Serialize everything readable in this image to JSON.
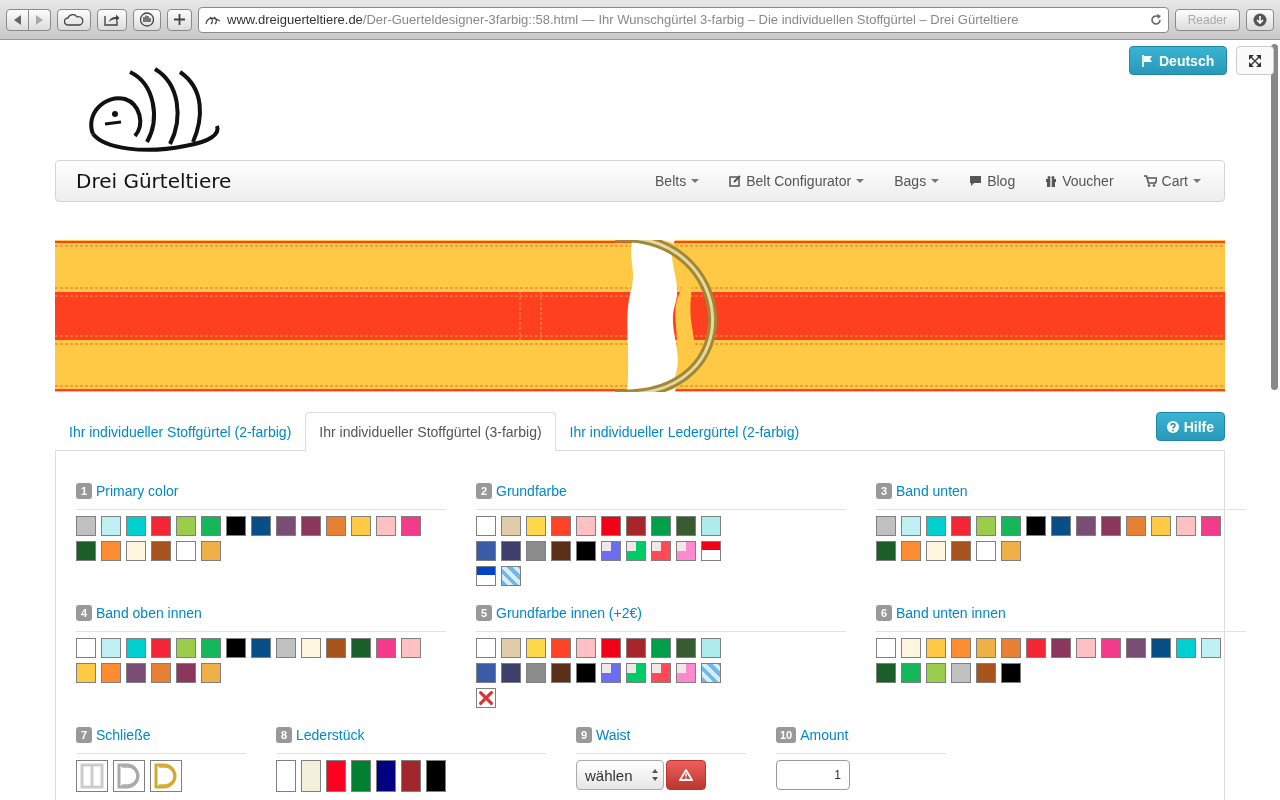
{
  "browser": {
    "url_domain": "www.dreiguerteltiere.de",
    "url_path": "/Der-Guerteldesigner-3farbig::58.html",
    "page_title": " — Ihr Wunschgürtel 3-farbig – Die individuellen Stoffgürtel – Drei Gürteltiere",
    "reader_button": "Reader"
  },
  "language_button": "Deutsch",
  "brand": "Drei Gürteltiere",
  "nav": [
    {
      "label": "Belts",
      "kind": "plain",
      "has_menu": true
    },
    {
      "label": "Belt Configurator",
      "kind": "edit",
      "has_menu": true
    },
    {
      "label": "Bags",
      "kind": "plain",
      "has_menu": true
    },
    {
      "label": "Blog",
      "kind": "comment",
      "has_menu": false
    },
    {
      "label": "Voucher",
      "kind": "gift",
      "has_menu": false
    },
    {
      "label": "Cart",
      "kind": "cart",
      "has_menu": true
    }
  ],
  "tabs": [
    {
      "label": "Ihr individueller Stoffgürtel (2-farbig)",
      "selected": false
    },
    {
      "label": "Ihr individueller Stoffgürtel (3-farbig)",
      "selected": true
    },
    {
      "label": "Ihr individueller Ledergürtel (2-farbig)",
      "selected": false
    }
  ],
  "help_button": "Hilfe",
  "sections": [
    {
      "number": "1",
      "title": "Primary color",
      "kind": "swatches",
      "swatches": [
        {
          "kind": "solid",
          "color": "#c0c0c0"
        },
        {
          "kind": "solid",
          "color": "#bff0f4"
        },
        {
          "kind": "solid",
          "color": "#00d0d0"
        },
        {
          "kind": "solid",
          "color": "#f42534"
        },
        {
          "kind": "solid",
          "color": "#9bcd4c"
        },
        {
          "kind": "solid",
          "color": "#14b85a"
        },
        {
          "kind": "solid",
          "color": "#000000"
        },
        {
          "kind": "solid",
          "color": "#074f88"
        },
        {
          "kind": "solid",
          "color": "#7a4d77"
        },
        {
          "kind": "solid",
          "color": "#8c365e"
        },
        {
          "kind": "solid",
          "color": "#e88034"
        },
        {
          "kind": "solid",
          "color": "#ffc845"
        },
        {
          "kind": "solid",
          "color": "#ffc0c4"
        },
        {
          "kind": "solid",
          "color": "#f43a8a"
        },
        {
          "kind": "solid",
          "color": "#1a5e2a"
        },
        {
          "kind": "solid",
          "color": "#ff8c30"
        },
        {
          "kind": "solid",
          "color": "#fff6e0"
        },
        {
          "kind": "solid",
          "color": "#a8521c"
        },
        {
          "kind": "solid",
          "color": "#ffffff"
        },
        {
          "kind": "solid",
          "color": "#f0b048"
        }
      ]
    },
    {
      "number": "2",
      "title": "Grundfarbe",
      "kind": "swatches",
      "swatches": [
        {
          "kind": "solid",
          "color": "#ffffff"
        },
        {
          "kind": "solid",
          "color": "#e2cba8"
        },
        {
          "kind": "solid",
          "color": "#ffd84a"
        },
        {
          "kind": "solid",
          "color": "#ff4326"
        },
        {
          "kind": "solid",
          "color": "#ffc0c4"
        },
        {
          "kind": "solid",
          "color": "#f20018"
        },
        {
          "kind": "solid",
          "color": "#a6262c"
        },
        {
          "kind": "solid",
          "color": "#00a04a"
        },
        {
          "kind": "solid",
          "color": "#375c32"
        },
        {
          "kind": "solid",
          "color": "#aeeceb"
        },
        {
          "kind": "solid",
          "color": "#3a5ca8"
        },
        {
          "kind": "solid",
          "color": "#3e3f6c"
        },
        {
          "kind": "solid",
          "color": "#8c8c8c"
        },
        {
          "kind": "solid",
          "color": "#5c3018"
        },
        {
          "kind": "solid",
          "color": "#000000"
        },
        {
          "kind": "check",
          "color": "#6b6ef0"
        },
        {
          "kind": "check",
          "color": "#00cc66"
        },
        {
          "kind": "check",
          "color": "#ff4a55"
        },
        {
          "kind": "check",
          "color": "#ff88d0"
        },
        {
          "kind": "split",
          "color": "#f20018"
        },
        {
          "kind": "split",
          "color": "#0044cc"
        },
        {
          "kind": "stripe",
          "color": "#70b8e8"
        }
      ]
    },
    {
      "number": "3",
      "title": "Band unten",
      "kind": "swatches",
      "swatches": [
        {
          "kind": "solid",
          "color": "#c0c0c0"
        },
        {
          "kind": "solid",
          "color": "#bff0f4"
        },
        {
          "kind": "solid",
          "color": "#00d0d0"
        },
        {
          "kind": "solid",
          "color": "#f42534"
        },
        {
          "kind": "solid",
          "color": "#9bcd4c"
        },
        {
          "kind": "solid",
          "color": "#14b85a"
        },
        {
          "kind": "solid",
          "color": "#000000"
        },
        {
          "kind": "solid",
          "color": "#074f88"
        },
        {
          "kind": "solid",
          "color": "#7a4d77"
        },
        {
          "kind": "solid",
          "color": "#8c365e"
        },
        {
          "kind": "solid",
          "color": "#e88034"
        },
        {
          "kind": "solid",
          "color": "#ffc845"
        },
        {
          "kind": "solid",
          "color": "#ffc0c4"
        },
        {
          "kind": "solid",
          "color": "#f43a8a"
        },
        {
          "kind": "solid",
          "color": "#1a5e2a"
        },
        {
          "kind": "solid",
          "color": "#ff8c30"
        },
        {
          "kind": "solid",
          "color": "#fff6e0"
        },
        {
          "kind": "solid",
          "color": "#a8521c"
        },
        {
          "kind": "solid",
          "color": "#ffffff"
        },
        {
          "kind": "solid",
          "color": "#f0b048"
        }
      ]
    },
    {
      "number": "4",
      "title": "Band oben innen",
      "kind": "swatches",
      "swatches": [
        {
          "kind": "solid",
          "color": "#ffffff"
        },
        {
          "kind": "solid",
          "color": "#bff0f4"
        },
        {
          "kind": "solid",
          "color": "#00d0d0"
        },
        {
          "kind": "solid",
          "color": "#f42534"
        },
        {
          "kind": "solid",
          "color": "#9bcd4c"
        },
        {
          "kind": "solid",
          "color": "#14b85a"
        },
        {
          "kind": "solid",
          "color": "#000000"
        },
        {
          "kind": "solid",
          "color": "#074f88"
        },
        {
          "kind": "solid",
          "color": "#c0c0c0"
        },
        {
          "kind": "solid",
          "color": "#fff6e0"
        },
        {
          "kind": "solid",
          "color": "#a8521c"
        },
        {
          "kind": "solid",
          "color": "#1a5e2a"
        },
        {
          "kind": "solid",
          "color": "#f43a8a"
        },
        {
          "kind": "solid",
          "color": "#ffc0c4"
        },
        {
          "kind": "solid",
          "color": "#ffc845"
        },
        {
          "kind": "solid",
          "color": "#ff8c30"
        },
        {
          "kind": "solid",
          "color": "#7a4d77"
        },
        {
          "kind": "solid",
          "color": "#e88034"
        },
        {
          "kind": "solid",
          "color": "#8c365e"
        },
        {
          "kind": "solid",
          "color": "#f0b048"
        }
      ]
    },
    {
      "number": "5",
      "title": "Grundfarbe innen (+2€)",
      "kind": "swatches",
      "swatches": [
        {
          "kind": "solid",
          "color": "#ffffff"
        },
        {
          "kind": "solid",
          "color": "#e2cba8"
        },
        {
          "kind": "solid",
          "color": "#ffd84a"
        },
        {
          "kind": "solid",
          "color": "#ff4326"
        },
        {
          "kind": "solid",
          "color": "#ffc0c4"
        },
        {
          "kind": "solid",
          "color": "#f20018"
        },
        {
          "kind": "solid",
          "color": "#a6262c"
        },
        {
          "kind": "solid",
          "color": "#00a04a"
        },
        {
          "kind": "solid",
          "color": "#375c32"
        },
        {
          "kind": "solid",
          "color": "#aeeceb"
        },
        {
          "kind": "solid",
          "color": "#3a5ca8"
        },
        {
          "kind": "solid",
          "color": "#3e3f6c"
        },
        {
          "kind": "solid",
          "color": "#8c8c8c"
        },
        {
          "kind": "solid",
          "color": "#5c3018"
        },
        {
          "kind": "solid",
          "color": "#000000"
        },
        {
          "kind": "check",
          "color": "#6b6ef0"
        },
        {
          "kind": "check",
          "color": "#00cc66"
        },
        {
          "kind": "check",
          "color": "#ff4a55"
        },
        {
          "kind": "check",
          "color": "#ff88d0"
        },
        {
          "kind": "stripe",
          "color": "#70b8e8"
        },
        {
          "kind": "none"
        }
      ]
    },
    {
      "number": "6",
      "title": "Band unten innen",
      "kind": "swatches",
      "swatches": [
        {
          "kind": "solid",
          "color": "#ffffff"
        },
        {
          "kind": "solid",
          "color": "#fff6e0"
        },
        {
          "kind": "solid",
          "color": "#ffc845"
        },
        {
          "kind": "solid",
          "color": "#ff8c30"
        },
        {
          "kind": "solid",
          "color": "#f0b048"
        },
        {
          "kind": "solid",
          "color": "#e88034"
        },
        {
          "kind": "solid",
          "color": "#f42534"
        },
        {
          "kind": "solid",
          "color": "#8c365e"
        },
        {
          "kind": "solid",
          "color": "#ffc0c4"
        },
        {
          "kind": "solid",
          "color": "#f43a8a"
        },
        {
          "kind": "solid",
          "color": "#7a4d77"
        },
        {
          "kind": "solid",
          "color": "#074f88"
        },
        {
          "kind": "solid",
          "color": "#00d0d0"
        },
        {
          "kind": "solid",
          "color": "#bff0f4"
        },
        {
          "kind": "solid",
          "color": "#1a5e2a"
        },
        {
          "kind": "solid",
          "color": "#14b85a"
        },
        {
          "kind": "solid",
          "color": "#9bcd4c"
        },
        {
          "kind": "solid",
          "color": "#c0c0c0"
        },
        {
          "kind": "solid",
          "color": "#a8521c"
        },
        {
          "kind": "solid",
          "color": "#000000"
        }
      ]
    },
    {
      "number": "7",
      "title": "Schließe",
      "kind": "clasps",
      "clasps": [
        {
          "kind": "frame",
          "color": "#cccccc"
        },
        {
          "kind": "dring",
          "color": "#aaaaaa"
        },
        {
          "kind": "dring",
          "color": "#d4aa30"
        }
      ]
    },
    {
      "number": "8",
      "title": "Lederstück",
      "kind": "leather",
      "swatches": [
        {
          "kind": "solid",
          "color": "#ffffff"
        },
        {
          "kind": "solid",
          "color": "#f3f0dc"
        },
        {
          "kind": "solid",
          "color": "#ff0020"
        },
        {
          "kind": "solid",
          "color": "#008030"
        },
        {
          "kind": "solid",
          "color": "#000080"
        },
        {
          "kind": "solid",
          "color": "#a0282c"
        },
        {
          "kind": "solid",
          "color": "#000000"
        }
      ]
    },
    {
      "number": "9",
      "title": "Waist",
      "kind": "select",
      "value": "wählen"
    },
    {
      "number": "10",
      "title": "Amount",
      "kind": "amount",
      "value": "1"
    }
  ]
}
